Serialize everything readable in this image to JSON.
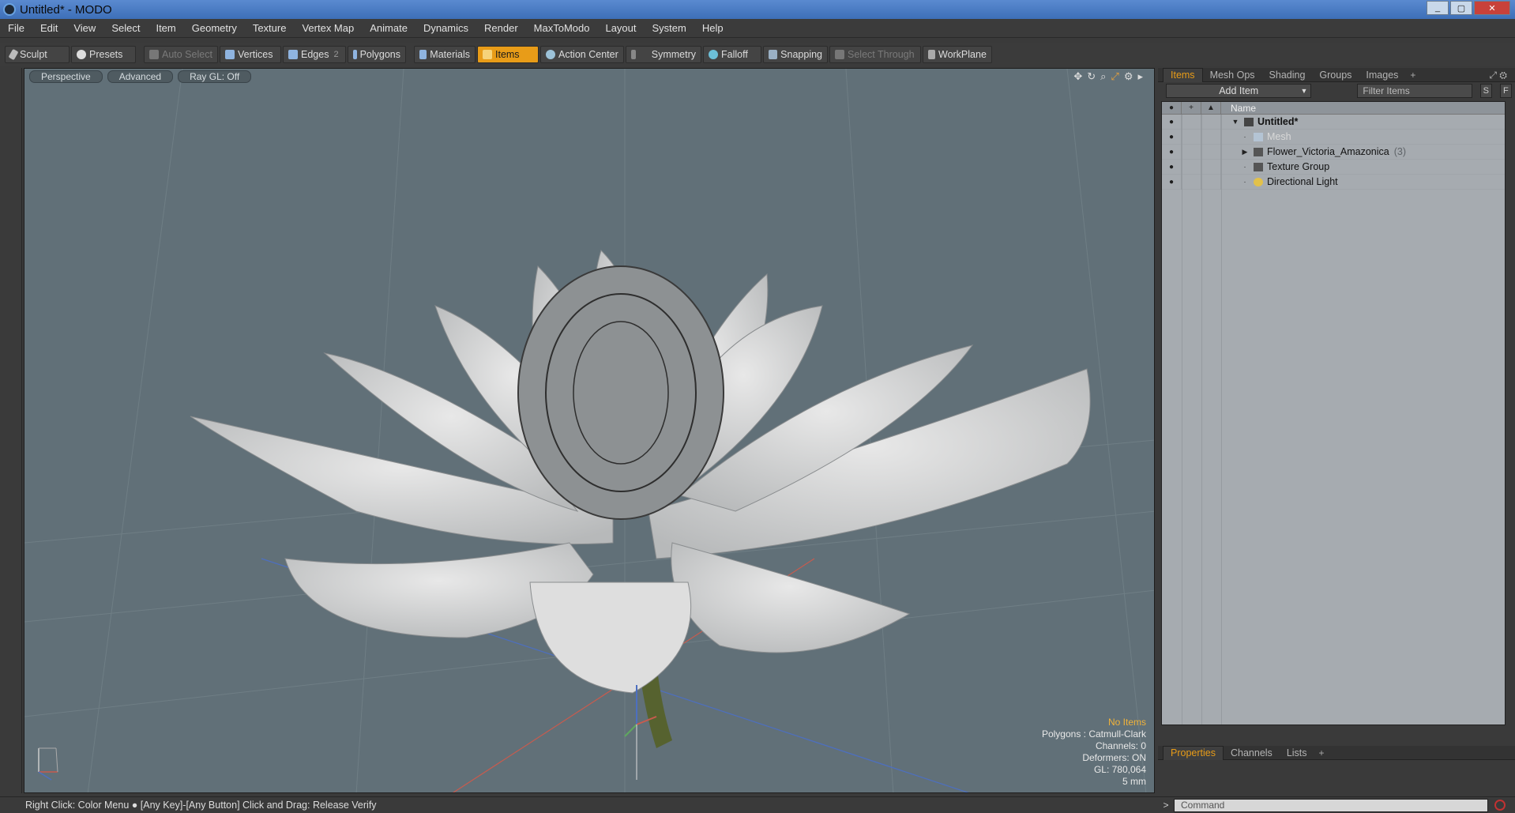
{
  "window": {
    "title": "Untitled* - MODO",
    "min": "_",
    "max": "▢",
    "close": "✕"
  },
  "menu": [
    "File",
    "Edit",
    "View",
    "Select",
    "Item",
    "Geometry",
    "Texture",
    "Vertex Map",
    "Animate",
    "Dynamics",
    "Render",
    "MaxToModo",
    "Layout",
    "System",
    "Help"
  ],
  "toolbar": {
    "sculpt": "Sculpt",
    "presets": "Presets",
    "auto_select": "Auto Select",
    "vertices": "Vertices",
    "edges": "Edges",
    "edges_count": "2",
    "polygons": "Polygons",
    "materials": "Materials",
    "items": "Items",
    "action_center": "Action Center",
    "symmetry": "Symmetry",
    "falloff": "Falloff",
    "snapping": "Snapping",
    "select_through": "Select Through",
    "workplane": "WorkPlane"
  },
  "viewport": {
    "tabs": [
      "Perspective",
      "Advanced",
      "Ray GL: Off"
    ],
    "stats": {
      "selection": "No Items",
      "polygons": "Polygons : Catmull-Clark",
      "channels": "Channels: 0",
      "deformers": "Deformers: ON",
      "gl": "GL: 780,064",
      "scale": "5 mm"
    }
  },
  "itemspanel": {
    "tabs": [
      "Items",
      "Mesh Ops",
      "Shading",
      "Groups",
      "Images"
    ],
    "add_item": "Add Item",
    "filter_placeholder": "Filter Items",
    "s_btn": "S",
    "f_btn": "F",
    "name_col": "Name",
    "items": [
      {
        "label": "Untitled*",
        "count": ""
      },
      {
        "label": "Mesh",
        "count": ""
      },
      {
        "label": "Flower_Victoria_Amazonica",
        "count": "(3)"
      },
      {
        "label": "Texture Group",
        "count": ""
      },
      {
        "label": "Directional Light",
        "count": ""
      }
    ]
  },
  "propertiespanel": {
    "tabs": [
      "Properties",
      "Channels",
      "Lists"
    ]
  },
  "status": {
    "hint": "Right Click: Color Menu ● [Any Key]-[Any Button] Click and Drag: Release Verify"
  },
  "command": {
    "placeholder": "Command",
    "prompt": ">"
  },
  "colors": {
    "accent": "#e89c18",
    "viewport_bg": "#617078"
  }
}
